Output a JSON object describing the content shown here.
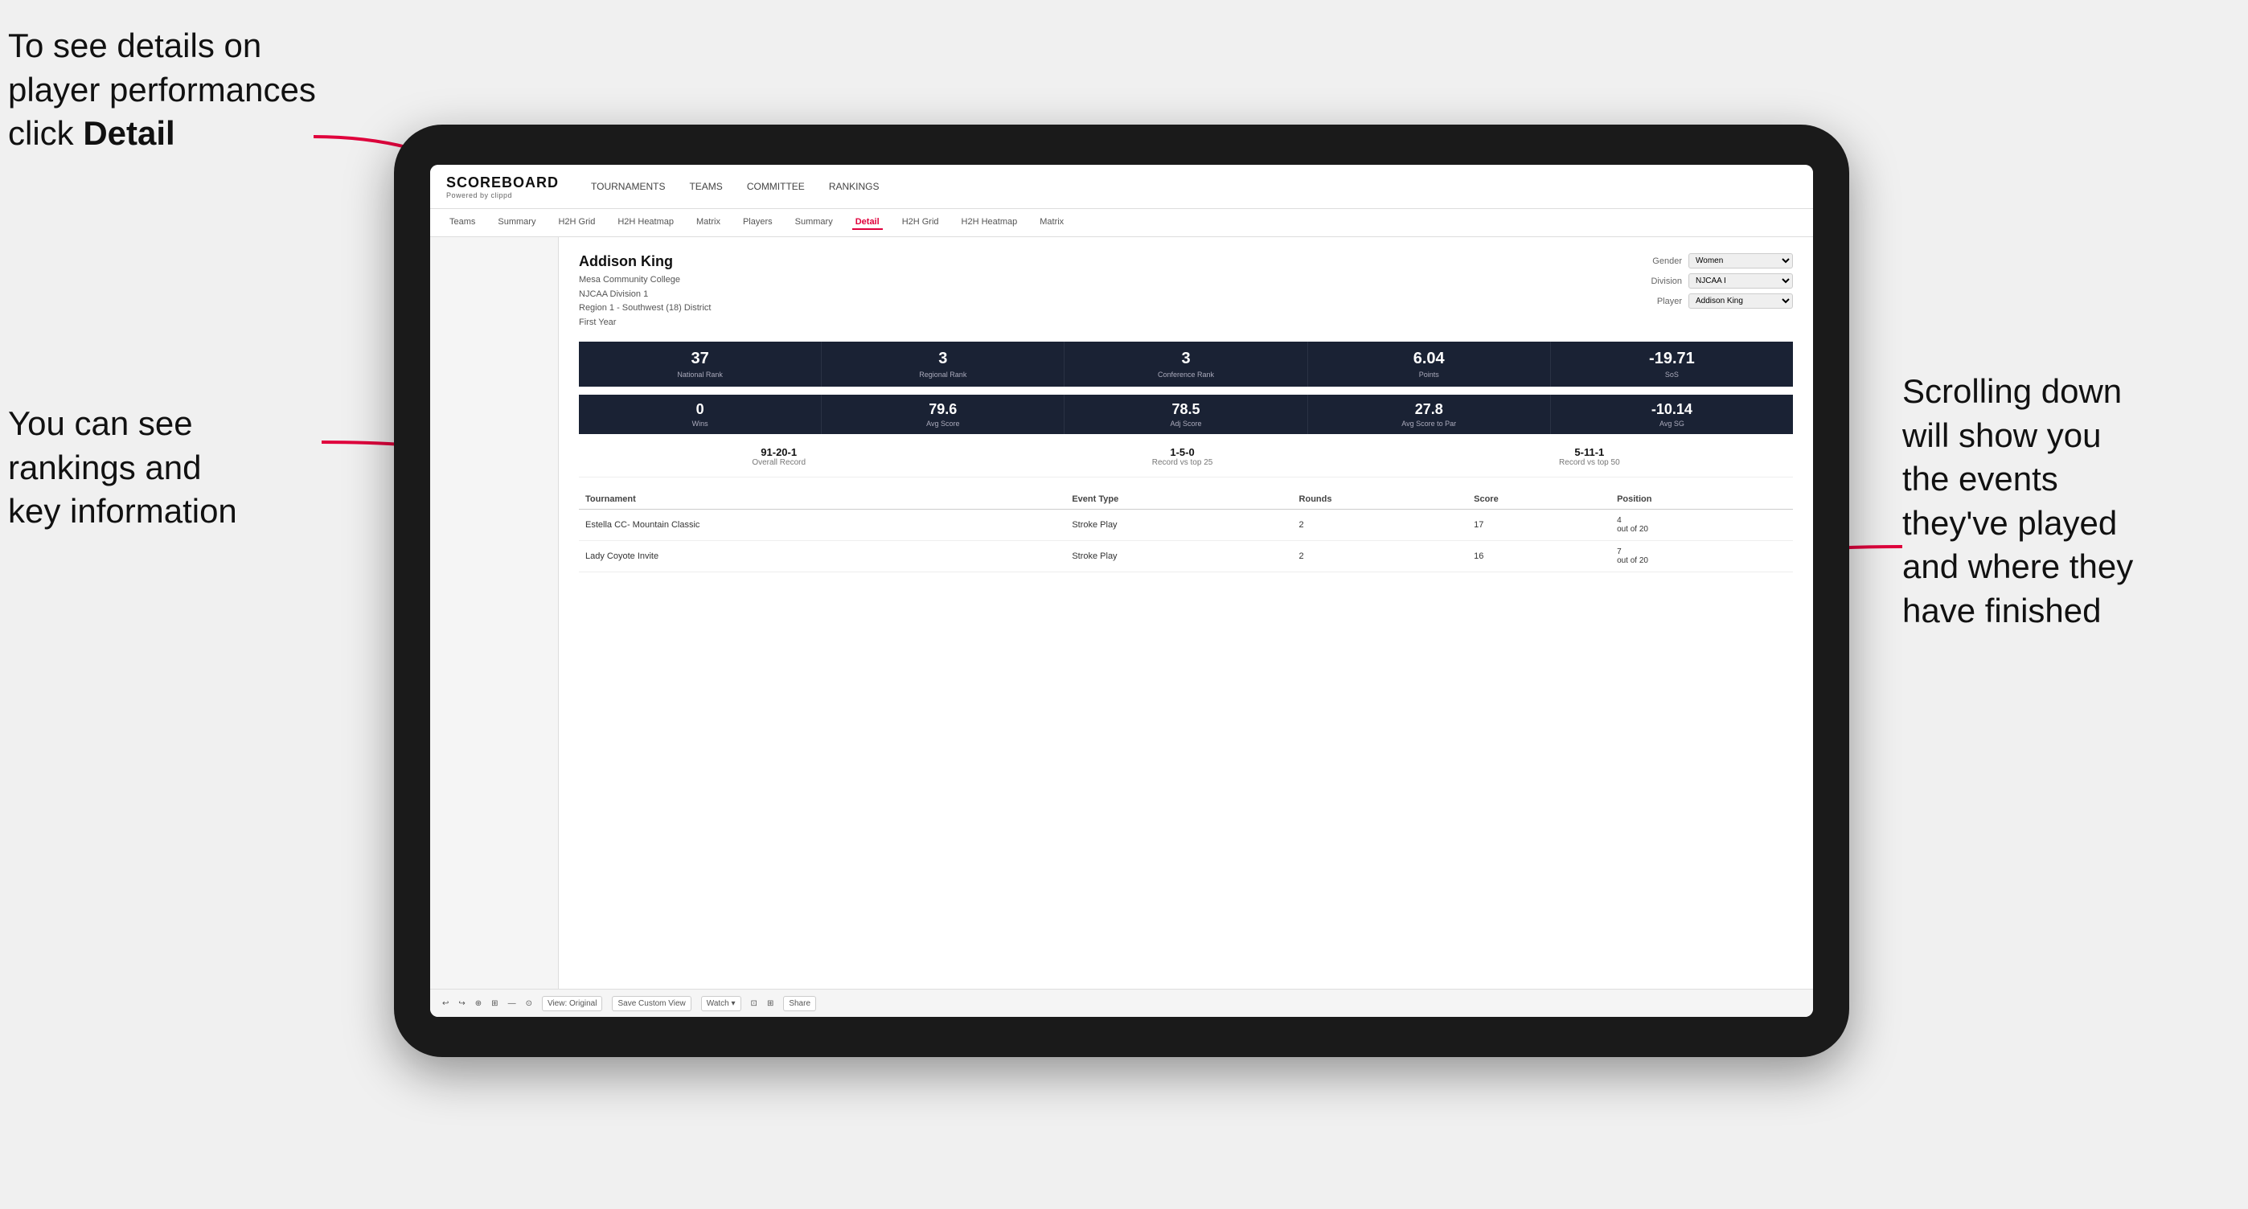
{
  "annotations": {
    "top_left": "To see details on player performances click ",
    "top_left_bold": "Detail",
    "bottom_left_line1": "You can see",
    "bottom_left_line2": "rankings and",
    "bottom_left_line3": "key information",
    "right_line1": "Scrolling down",
    "right_line2": "will show you",
    "right_line3": "the events",
    "right_line4": "they've played",
    "right_line5": "and where they",
    "right_line6": "have finished"
  },
  "app": {
    "logo": "SCOREBOARD",
    "logo_sub": "Powered by clippd",
    "nav": [
      "TOURNAMENTS",
      "TEAMS",
      "COMMITTEE",
      "RANKINGS"
    ],
    "sub_nav": [
      "Teams",
      "Summary",
      "H2H Grid",
      "H2H Heatmap",
      "Matrix",
      "Players",
      "Summary",
      "Detail",
      "H2H Grid",
      "H2H Heatmap",
      "Matrix"
    ],
    "active_tab": "Detail"
  },
  "player": {
    "name": "Addison King",
    "school": "Mesa Community College",
    "division": "NJCAA Division 1",
    "region": "Region 1 - Southwest (18) District",
    "year": "First Year"
  },
  "controls": {
    "gender_label": "Gender",
    "gender_value": "Women",
    "division_label": "Division",
    "division_value": "NJCAA I",
    "player_label": "Player",
    "player_value": "Addison King"
  },
  "stats_row1": [
    {
      "value": "37",
      "label": "National Rank"
    },
    {
      "value": "3",
      "label": "Regional Rank"
    },
    {
      "value": "3",
      "label": "Conference Rank"
    },
    {
      "value": "6.04",
      "label": "Points"
    },
    {
      "value": "-19.71",
      "label": "SoS"
    }
  ],
  "stats_row2": [
    {
      "value": "0",
      "label": "Wins"
    },
    {
      "value": "79.6",
      "label": "Avg Score"
    },
    {
      "value": "78.5",
      "label": "Adj Score"
    },
    {
      "value": "27.8",
      "label": "Avg Score to Par"
    },
    {
      "value": "-10.14",
      "label": "Avg SG"
    }
  ],
  "records": [
    {
      "value": "91-20-1",
      "label": "Overall Record"
    },
    {
      "value": "1-5-0",
      "label": "Record vs top 25"
    },
    {
      "value": "5-11-1",
      "label": "Record vs top 50"
    }
  ],
  "table": {
    "headers": [
      "Tournament",
      "Event Type",
      "Rounds",
      "Score",
      "Position"
    ],
    "rows": [
      {
        "tournament": "Estella CC- Mountain Classic",
        "event_type": "Stroke Play",
        "rounds": "2",
        "score": "17",
        "position": "4\nout of 20"
      },
      {
        "tournament": "Lady Coyote Invite",
        "event_type": "Stroke Play",
        "rounds": "2",
        "score": "16",
        "position": "7\nout of 20"
      }
    ]
  },
  "toolbar": {
    "buttons": [
      "View: Original",
      "Save Custom View",
      "Watch ▾",
      "Share"
    ]
  }
}
